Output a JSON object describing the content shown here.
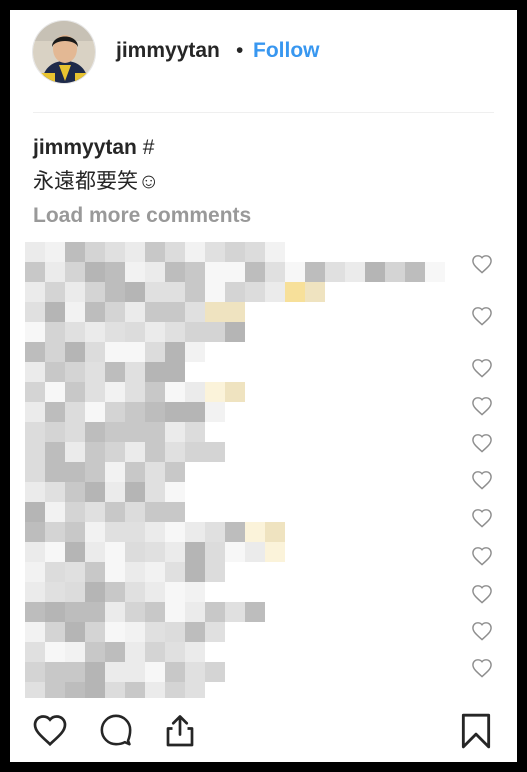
{
  "header": {
    "username": "jimmyytan",
    "separator": "•",
    "follow_label": "Follow"
  },
  "caption": {
    "username": "jimmyytan",
    "hashtag": "#",
    "text": "永遠都要笑☺"
  },
  "comments": {
    "load_more_label": "Load more comments",
    "count_visible": 13
  },
  "actions": {
    "icons": [
      "heart-icon",
      "comment-icon",
      "share-icon",
      "bookmark-icon"
    ]
  },
  "colors": {
    "accent": "#3897f0",
    "text": "#262626",
    "muted": "#999999",
    "frame": "#000000"
  }
}
